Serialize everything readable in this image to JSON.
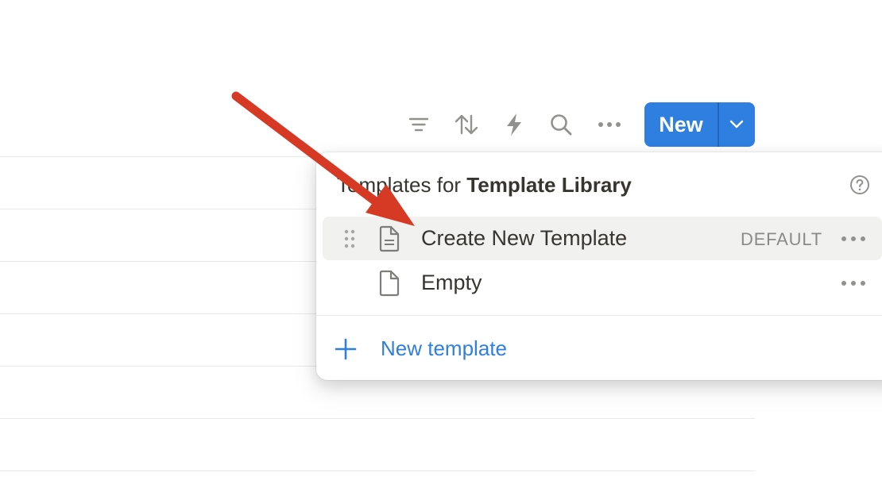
{
  "toolbar": {
    "icons": [
      "filter-icon",
      "sort-icon",
      "lightning-icon",
      "search-icon",
      "more-icon"
    ],
    "new_button_label": "New"
  },
  "templates_menu": {
    "title_prefix": "Templates for ",
    "title_db": "Template Library",
    "items": [
      {
        "label": "Create New Template",
        "badge": "DEFAULT"
      },
      {
        "label": "Empty"
      }
    ],
    "add_label": "New template"
  },
  "colors": {
    "accent": "#2f7fe0",
    "annotation_arrow": "#d63a24"
  }
}
